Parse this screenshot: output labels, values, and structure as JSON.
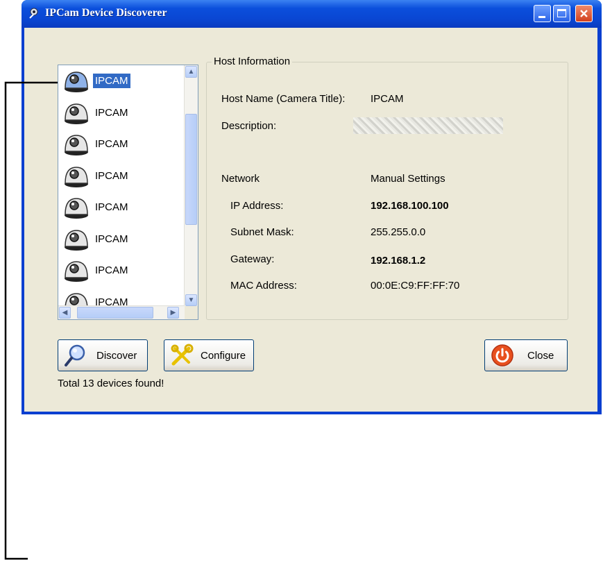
{
  "window": {
    "title": "IPCam Device Discoverer"
  },
  "devices": [
    {
      "label": "IPCAM"
    },
    {
      "label": "IPCAM"
    },
    {
      "label": "IPCAM"
    },
    {
      "label": "IPCAM"
    },
    {
      "label": "IPCAM"
    },
    {
      "label": "IPCAM"
    },
    {
      "label": "IPCAM"
    },
    {
      "label": "IPCAM"
    }
  ],
  "host": {
    "group_title": "Host Information",
    "name_label": "Host Name (Camera Title):",
    "name_value": "IPCAM",
    "desc_label": "Description:",
    "network_label": "Network",
    "network_mode": "Manual Settings",
    "ip_label": "IP Address:",
    "ip_value": "192.168.100.100",
    "mask_label": "Subnet Mask:",
    "mask_value": "255.255.0.0",
    "gw_label": "Gateway:",
    "gw_value": "192.168.1.2",
    "mac_label": "MAC Address:",
    "mac_value": "00:0E:C9:FF:FF:70"
  },
  "buttons": {
    "discover": "Discover",
    "configure": "Configure",
    "close": "Close"
  },
  "status": "Total 13 devices found!",
  "colors": {
    "titlebar": "#0a46d2",
    "selection": "#316ac5",
    "face": "#ece9d8"
  },
  "icons": {
    "app": "camera-icon",
    "device": "dome-camera-icon",
    "discover": "magnifier-icon",
    "configure": "tools-icon",
    "close": "power-icon"
  }
}
